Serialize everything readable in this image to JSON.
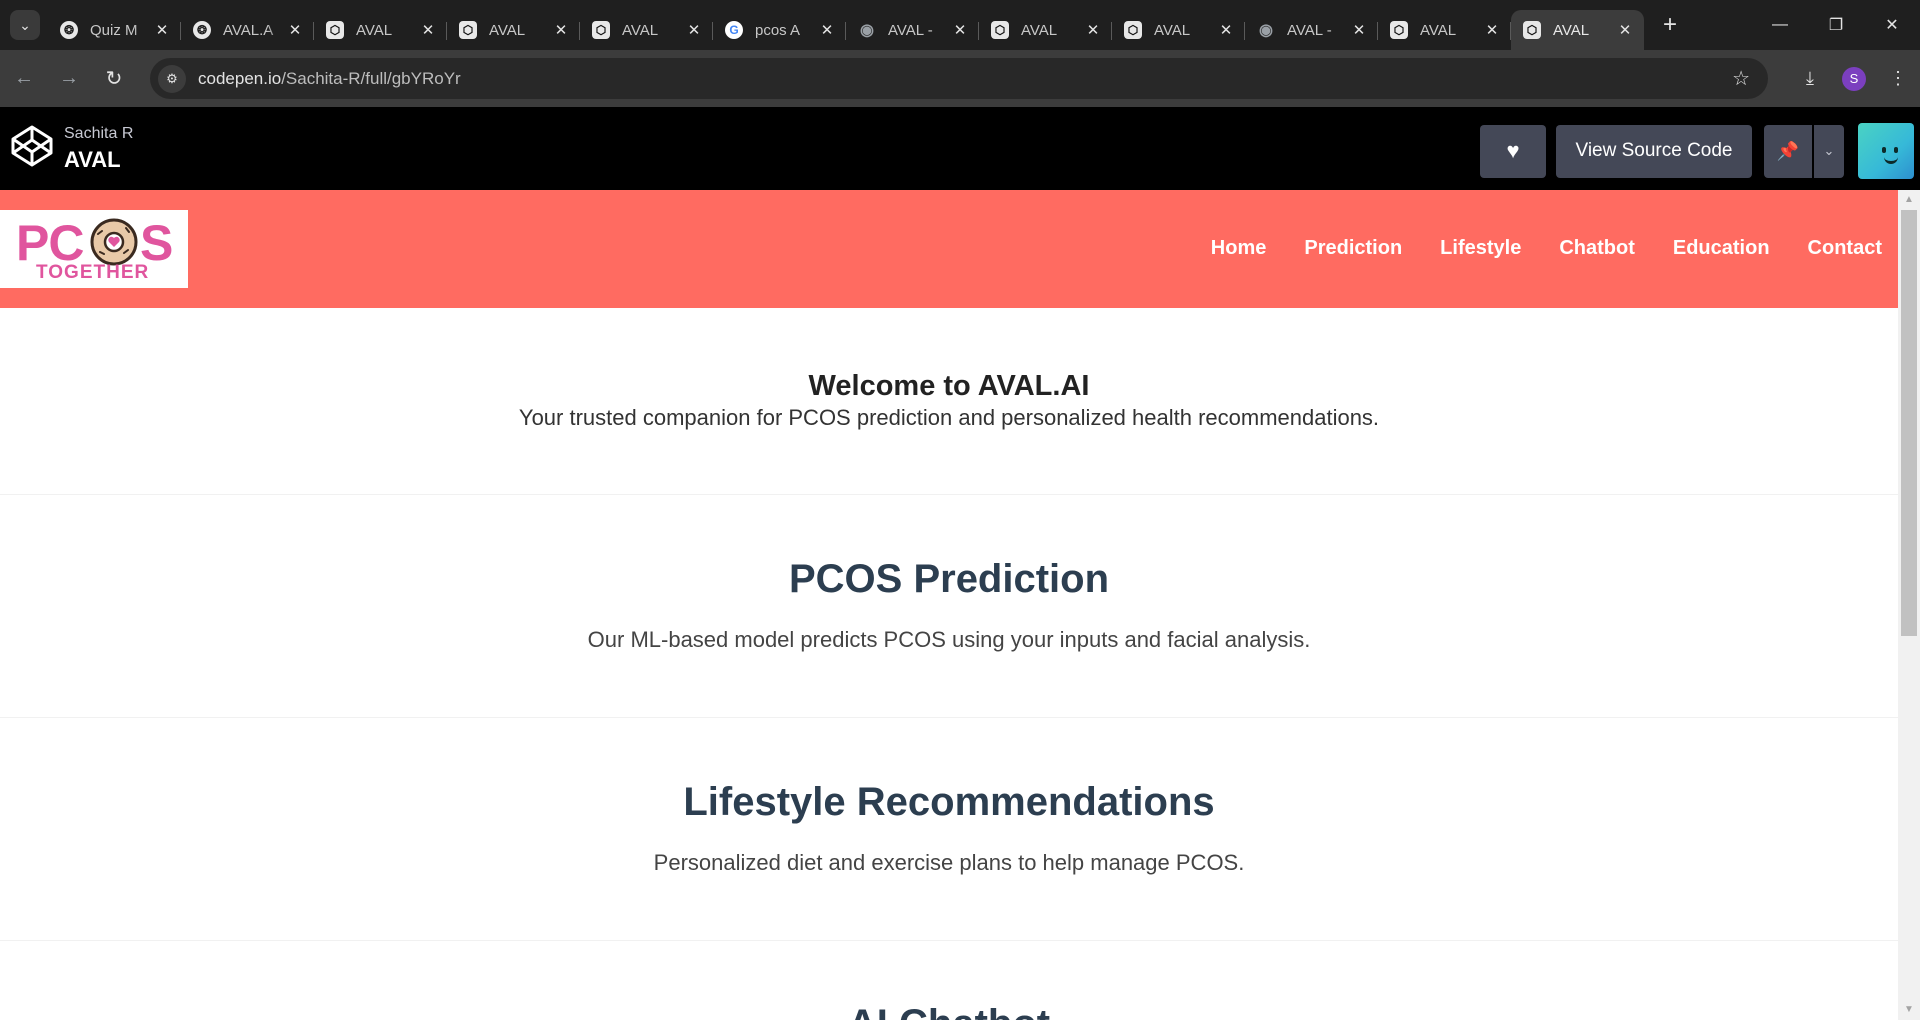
{
  "browser": {
    "tabs": [
      {
        "title": "Quiz M",
        "icon": "chatgpt-icon"
      },
      {
        "title": "AVAL.A",
        "icon": "chatgpt-icon"
      },
      {
        "title": "AVAL",
        "icon": "codepen-icon"
      },
      {
        "title": "AVAL",
        "icon": "codepen-icon"
      },
      {
        "title": "AVAL",
        "icon": "codepen-icon"
      },
      {
        "title": "pcos A",
        "icon": "google-icon"
      },
      {
        "title": "AVAL -",
        "icon": "globe-icon"
      },
      {
        "title": "AVAL",
        "icon": "codepen-icon"
      },
      {
        "title": "AVAL",
        "icon": "codepen-icon"
      },
      {
        "title": "AVAL -",
        "icon": "globe-icon"
      },
      {
        "title": "AVAL",
        "icon": "codepen-icon"
      },
      {
        "title": "AVAL",
        "icon": "codepen-icon",
        "active": true
      }
    ],
    "url_domain": "codepen.io",
    "url_path": "/Sachita-R/full/gbYRoYr",
    "profile_initial": "S"
  },
  "codepen": {
    "author": "Sachita R",
    "pen_title": "AVAL",
    "view_source_label": "View Source Code"
  },
  "site": {
    "brand_pc": "PC",
    "brand_s": "S",
    "brand_together": "TOGETHER",
    "nav": [
      "Home",
      "Prediction",
      "Lifestyle",
      "Chatbot",
      "Education",
      "Contact"
    ],
    "hero_title": "Welcome to AVAL.AI",
    "hero_sub": "Your trusted companion for PCOS prediction and personalized health recommendations.",
    "sections": [
      {
        "title": "PCOS Prediction",
        "text": "Our ML-based model predicts PCOS using your inputs and facial analysis."
      },
      {
        "title": "Lifestyle Recommendations",
        "text": "Personalized diet and exercise plans to help manage PCOS."
      },
      {
        "title": "AI Chatbot",
        "text": ""
      }
    ],
    "colors": {
      "nav_bg": "#ff6b61",
      "brand_pink": "#e0559e",
      "heading": "#2c3e50"
    }
  }
}
